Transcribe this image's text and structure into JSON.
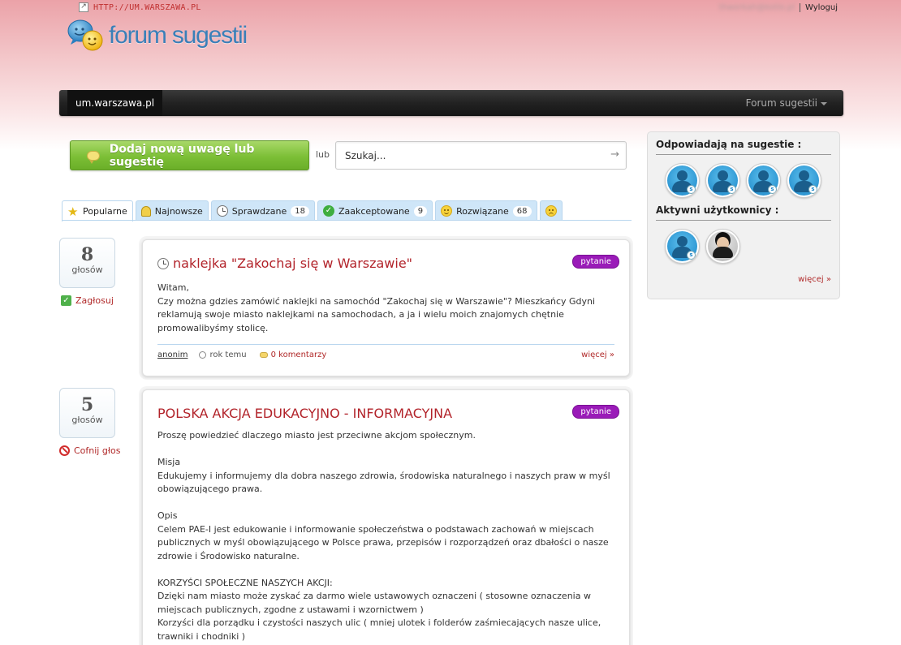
{
  "header": {
    "ext_link": "HTTP://UM.WARSZAWA.PL",
    "user_email": "thwerkah@kotlo.pl",
    "logout": "Wyloguj",
    "logo_text": "forum sugestii"
  },
  "nav": {
    "home": "um.warszawa.pl",
    "forum": "Forum sugestii"
  },
  "actions": {
    "add_button": "Dodaj nową uwagę lub sugestię",
    "or_label": "lub",
    "search_placeholder": "Szukaj...",
    "search_arrow": "→"
  },
  "tabs": [
    {
      "label": "Popularne",
      "icon": "star-icon",
      "count": ""
    },
    {
      "label": "Najnowsze",
      "icon": "bell-icon",
      "count": ""
    },
    {
      "label": "Sprawdzane",
      "icon": "clock-icon",
      "count": "18"
    },
    {
      "label": "Zaakceptowane",
      "icon": "check-icon",
      "count": "9"
    },
    {
      "label": "Rozwiązane",
      "icon": "smile-icon",
      "count": "68"
    },
    {
      "label": "",
      "icon": "sad-icon",
      "count": ""
    }
  ],
  "posts": [
    {
      "votes": "8",
      "votes_label": "głosów",
      "vote_action": "Zagłosuj",
      "title": "naklejka \"Zakochaj się w Warszawie\"",
      "tag": "pytanie",
      "body": "Witam,\nCzy można gdzies zamówić naklejki na samochód \"Zakochaj się w Warszawie\"? Mieszkańcy Gdyni reklamują swoje miasto naklejkami na samochodach, a ja i wielu moich znajomych chętnie promowalibyśmy stolicę.",
      "author": "anonim",
      "time": "rok temu",
      "comments": "0 komentarzy",
      "more": "więcej »"
    },
    {
      "votes": "5",
      "votes_label": "głosów",
      "vote_action": "Cofnij głos",
      "title": "POLSKA AKCJA EDUKACYJNO - INFORMACYJNA",
      "tag": "pytanie",
      "body": "Proszę powiedzieć dlaczego miasto jest przeciwne akcjom społecznym.\n\nMisja\nEdukujemy i informujemy dla dobra naszego zdrowia, środowiska naturalnego i naszych praw w myśl obowiązującego prawa.\n\nOpis\nCelem PAE-I jest edukowanie i informowanie społeczeństwa o podstawach zachowań w miejscach publicznych w myśl obowiązującego w Polsce prawa, przepisów i rozporządzeń oraz dbałości o nasze zdrowie i Środowisko naturalne.\n\nKORZYŚCI SPOŁECZNE NASZYCH AKCJI:\nDzięki nam miasto może zyskać za darmo wiele ustawowych oznaczeni ( stosowne oznaczenia w miejscach publicznych, zgodne z ustawami i wzornictwem )\nKorzyści dla porządku i czystości naszych ulic ( mniej ulotek i folderów zaśmiecających nasze ulice, trawniki i chodniki )"
    }
  ],
  "sidebar": {
    "responders_heading": "Odpowiadają na sugestie :",
    "active_heading": "Aktywni użytkownicy :",
    "more": "więcej »",
    "badge": "s"
  }
}
